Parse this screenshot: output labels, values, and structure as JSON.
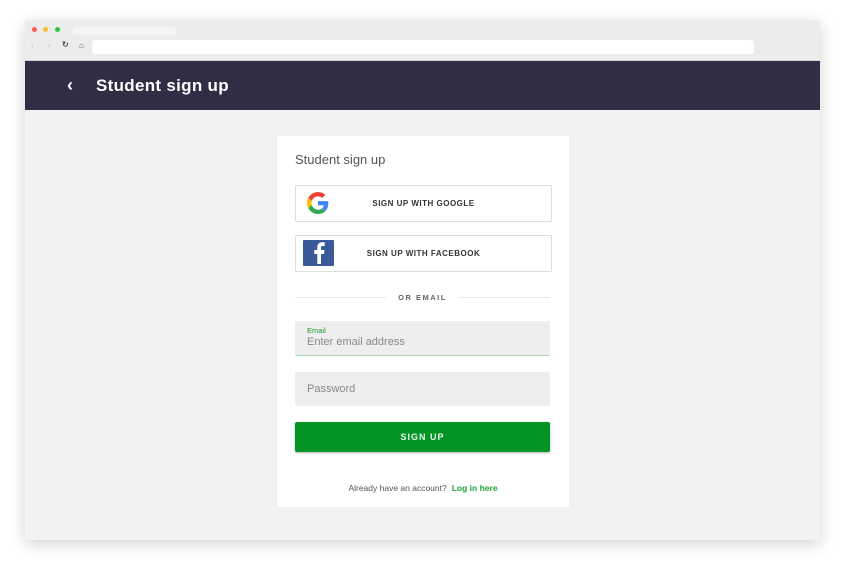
{
  "header": {
    "title": "Student sign up"
  },
  "card": {
    "title": "Student sign up",
    "google_label": "SIGN UP WITH GOOGLE",
    "facebook_label": "SIGN UP WITH FACEBOOK",
    "divider": "OR EMAIL",
    "email_label": "Email",
    "email_placeholder": "Enter email address",
    "password_placeholder": "Password",
    "submit_label": "SIGN UP",
    "footer_text": "Already have an account?",
    "login_link": "Log in here"
  },
  "colors": {
    "header": "#302e45",
    "accent": "#029526"
  }
}
